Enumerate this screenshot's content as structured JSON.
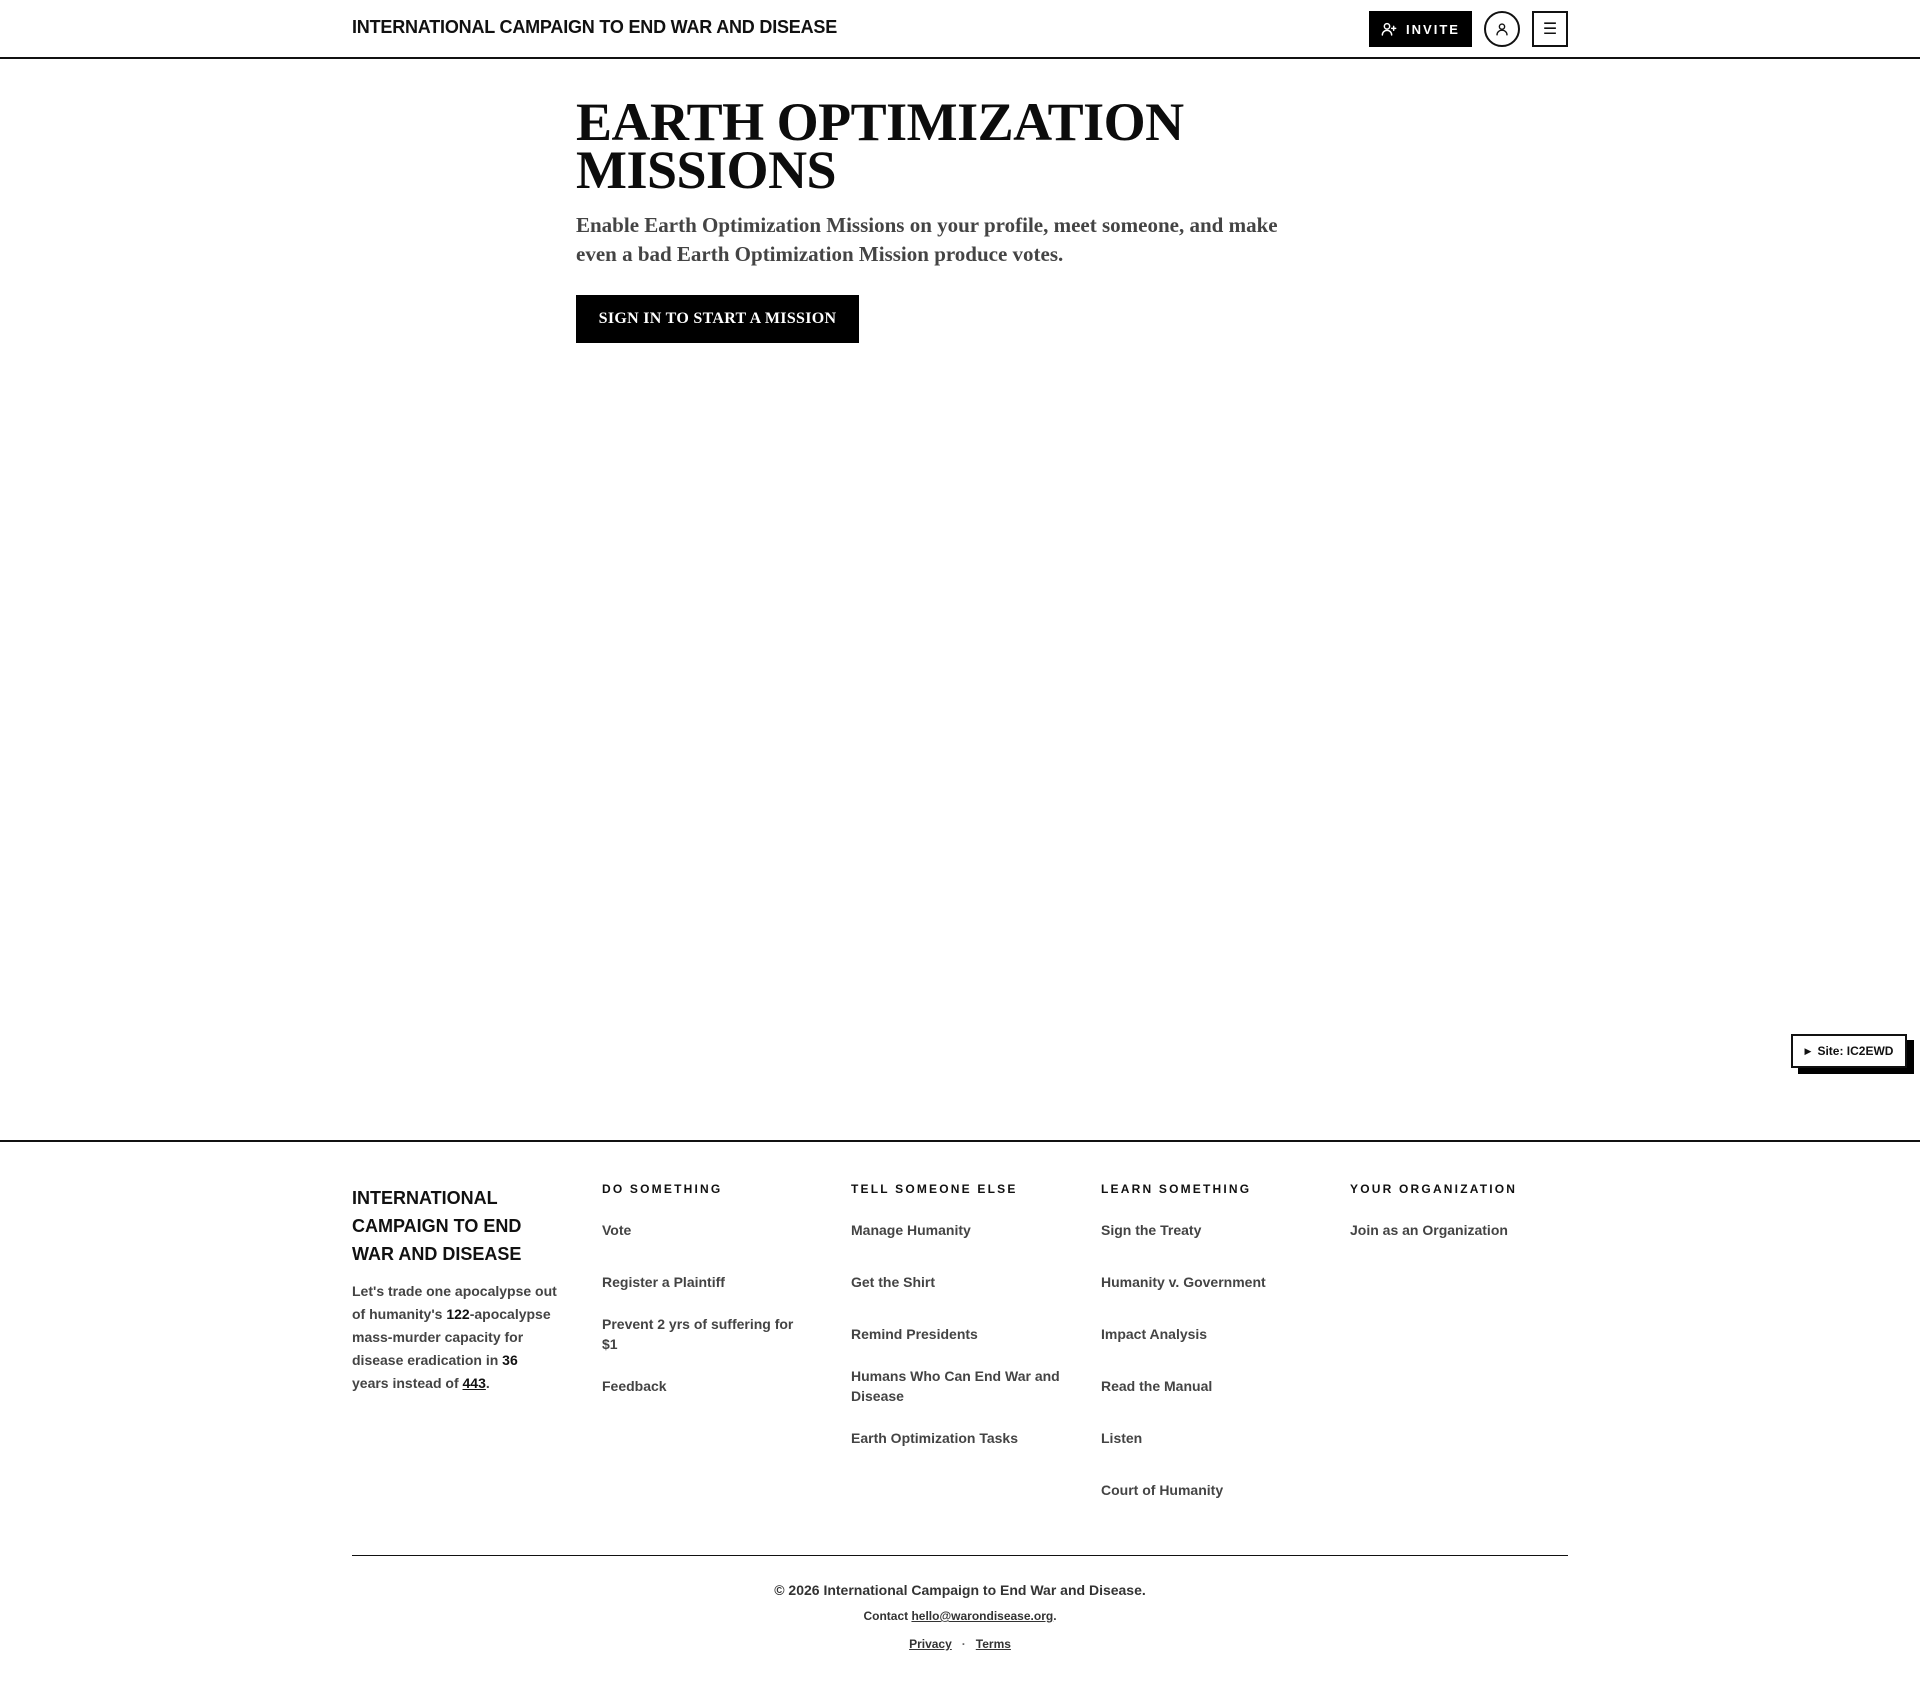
{
  "header": {
    "brand": "INTERNATIONAL CAMPAIGN TO END WAR AND DISEASE",
    "invite_label": "INVITE",
    "menu_glyph": "☰"
  },
  "hero": {
    "title": "EARTH OPTIMIZATION MISSIONS",
    "subtitle": "Enable Earth Optimization Missions on your profile, meet someone, and make even a bad Earth Optimization Mission produce votes.",
    "cta_label": "SIGN IN TO START A MISSION"
  },
  "site_badge": {
    "glyph": "▶",
    "label": "Site: IC2EWD"
  },
  "footer": {
    "brand": "INTERNATIONAL CAMPAIGN TO END WAR AND DISEASE",
    "tagline": {
      "part1": "Let's trade one apocalypse out of humanity's ",
      "n1": "122",
      "part2": "-apocalypse mass-murder capacity for disease eradication in ",
      "n2": "36",
      "part3": " years instead of ",
      "n3": "443",
      "part4": "."
    },
    "columns": [
      {
        "heading": "DO SOMETHING",
        "items": [
          "Vote",
          "Register a Plaintiff",
          "Prevent 2 yrs of suffering for $1",
          "Feedback"
        ]
      },
      {
        "heading": "TELL SOMEONE ELSE",
        "items": [
          "Manage Humanity",
          "Get the Shirt",
          "Remind Presidents",
          "Humans Who Can End War and Disease",
          "Earth Optimization Tasks"
        ]
      },
      {
        "heading": "LEARN SOMETHING",
        "items": [
          "Sign the Treaty",
          "Humanity v. Government",
          "Impact Analysis",
          "Read the Manual",
          "Listen",
          "Court of Humanity"
        ]
      },
      {
        "heading": "YOUR ORGANIZATION",
        "items": [
          "Join as an Organization"
        ]
      }
    ],
    "copyright": "© 2026 International Campaign to End War and Disease.",
    "contact_prefix": "Contact ",
    "contact_email": "hello@warondisease.org",
    "contact_suffix": ".",
    "privacy_label": "Privacy",
    "separator": "·",
    "terms_label": "Terms"
  },
  "icons": {
    "invite": "user-plus-icon",
    "avatar": "user-icon",
    "menu": "hamburger-menu-icon"
  }
}
